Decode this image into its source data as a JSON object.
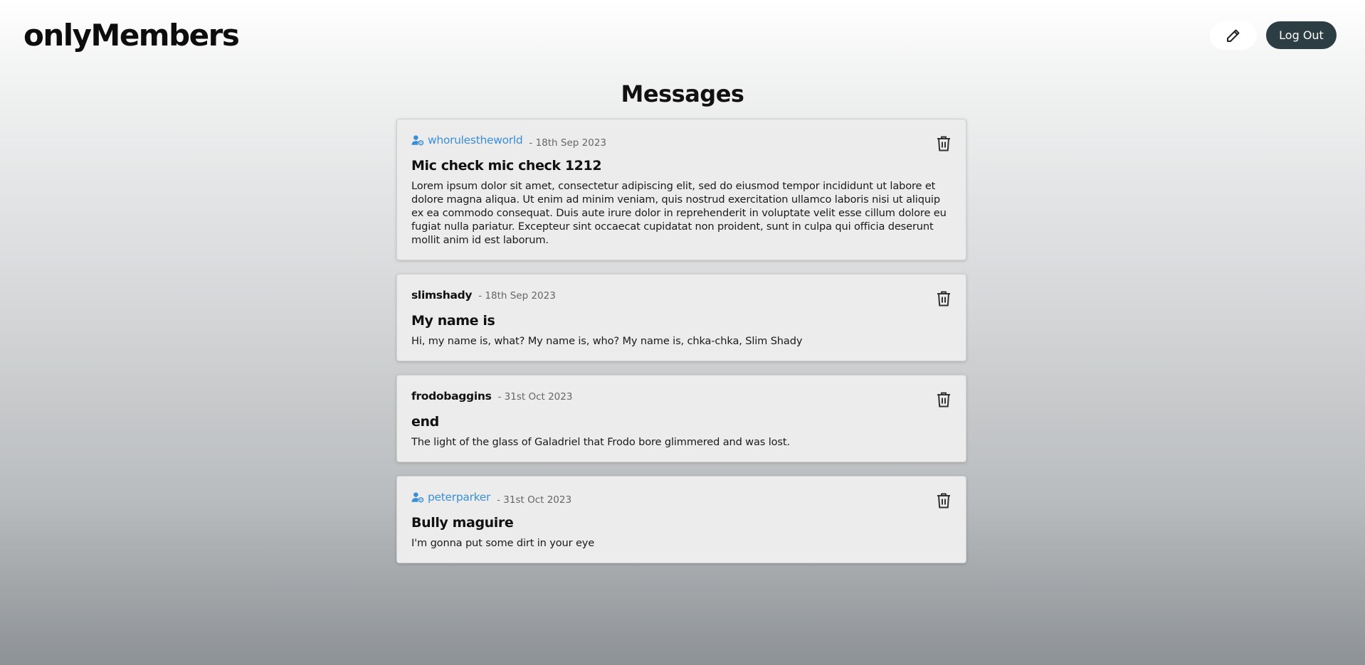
{
  "app": {
    "brand": "onlyMembers"
  },
  "header": {
    "edit_icon": "pencil-icon",
    "logout_label": "Log Out"
  },
  "page": {
    "title": "Messages"
  },
  "messages": [
    {
      "author": "whorulestheworld",
      "is_member": true,
      "date": "- 18th Sep 2023",
      "title": "Mic check mic check 1212",
      "body": "Lorem ipsum dolor sit amet, consectetur adipiscing elit, sed do eiusmod tempor incididunt ut labore et dolore magna aliqua. Ut enim ad minim veniam, quis nostrud exercitation ullamco laboris nisi ut aliquip ex ea commodo consequat. Duis aute irure dolor in reprehenderit in voluptate velit esse cillum dolore eu fugiat nulla pariatur. Excepteur sint occaecat cupidatat non proident, sunt in culpa qui officia deserunt mollit anim id est laborum."
    },
    {
      "author": "slimshady",
      "is_member": false,
      "date": "- 18th Sep 2023",
      "title": "My name is",
      "body": "Hi, my name is, what? My name is, who? My name is, chka-chka, Slim Shady"
    },
    {
      "author": "frodobaggins",
      "is_member": false,
      "date": "- 31st Oct 2023",
      "title": "end",
      "body": "The light of the glass of Galadriel that Frodo bore glimmered and was lost."
    },
    {
      "author": "peterparker",
      "is_member": true,
      "date": "- 31st Oct 2023",
      "title": "Bully maguire",
      "body": "I'm gonna put some dirt in your eye"
    }
  ],
  "colors": {
    "member_accent": "#3a8fd6",
    "logout_bg": "#2c3e44",
    "card_bg": "#ececec"
  }
}
